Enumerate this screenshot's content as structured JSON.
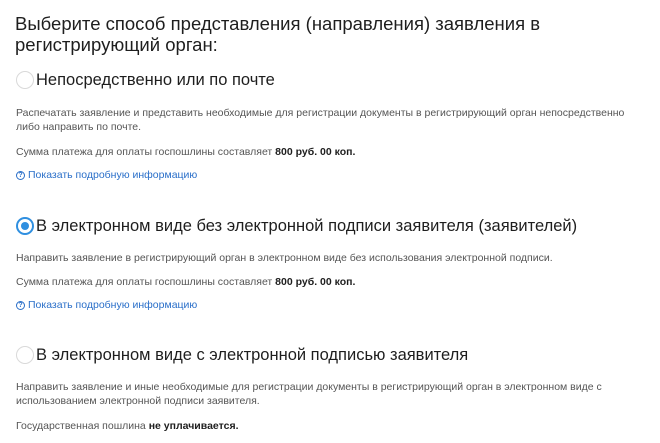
{
  "heading": "Выберите способ представления (направления) заявления в регистрирующий орган:",
  "options": [
    {
      "title": "Непосредственно или по почте",
      "selected": false,
      "description": "Распечатать заявление и представить необходимые для регистрации документы в регистрирующий орган непосредственно либо направить по почте.",
      "fee_prefix": "Сумма платежа для оплаты госпошлины составляет ",
      "fee_value": "800 руб. 00 коп.",
      "link_icon": "?",
      "link": "Показать подробную информацию"
    },
    {
      "title": "В электронном виде без электронной подписи заявителя (заявителей)",
      "selected": true,
      "description": "Направить заявление в регистрирующий орган в электронном виде без использования электронной подписи.",
      "fee_prefix": "Сумма платежа для оплаты госпошлины составляет ",
      "fee_value": "800 руб. 00 коп.",
      "link_icon": "?",
      "link": "Показать подробную информацию"
    },
    {
      "title": "В электронном виде с электронной подписью заявителя",
      "selected": false,
      "description": "Направить заявление и иные необходимые для регистрации документы в регистрирующий орган в электронном виде с использованием электронной подписи заявителя.",
      "fee_prefix": "Государственная пошлина ",
      "fee_value": "не уплачивается."
    }
  ],
  "colors": {
    "accent": "#2f8fe0",
    "link": "#2a6fc9"
  },
  "icons": {
    "radio_selected": "radio-selected-icon",
    "radio_empty": "radio-empty-icon",
    "help": "question-circle-icon"
  }
}
